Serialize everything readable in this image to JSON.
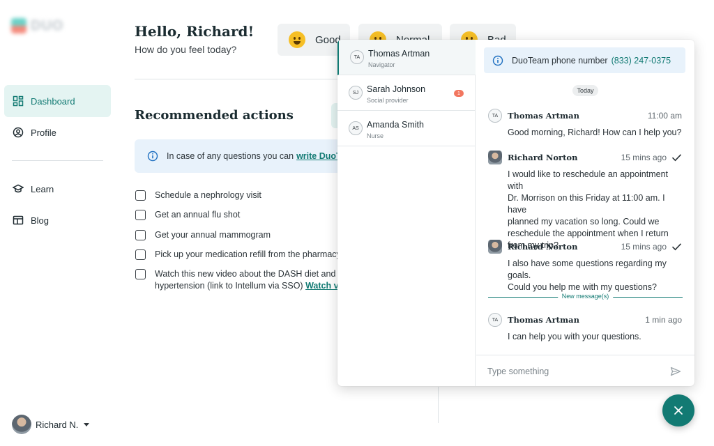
{
  "brand": {
    "logo_text": "DUO"
  },
  "sidebar": {
    "items": [
      {
        "label": "Dashboard",
        "icon": "dashboard-icon",
        "active": true
      },
      {
        "label": "Profile",
        "icon": "profile-icon",
        "active": false
      },
      {
        "label": "Learn",
        "icon": "graduation-cap-icon",
        "active": false
      },
      {
        "label": "Blog",
        "icon": "blog-icon",
        "active": false
      }
    ],
    "user": {
      "name": "Richard N."
    }
  },
  "header": {
    "greeting": "Hello, Richard!",
    "question": "How do you feel today?",
    "moods": [
      "Good",
      "Normal",
      "Bad"
    ]
  },
  "recommended": {
    "title": "Recommended actions",
    "info_text": "In case of any questions you can",
    "info_link": "write DuoTeam",
    "tasks": [
      {
        "text": "Schedule a nephrology visit"
      },
      {
        "text": "Get an annual flu shot"
      },
      {
        "text": "Get your annual mammogram"
      },
      {
        "text": "Pick up your medication refill from the pharmacy"
      },
      {
        "text_line1": "Watch this new video about the DASH diet and its",
        "text_line2": "hypertension (link to Intellum via SSO)",
        "link": "Watch video"
      }
    ]
  },
  "chat": {
    "contacts": [
      {
        "initials": "TA",
        "name": "Thomas Artman",
        "role": "Navigator",
        "unread": null
      },
      {
        "initials": "SJ",
        "name": "Sarah Johnson",
        "role": "Social provider",
        "unread": "1"
      },
      {
        "initials": "AS",
        "name": "Amanda Smith",
        "role": "Nurse",
        "unread": null
      }
    ],
    "phone_label": "DuoTeam phone number",
    "phone_number": "(833) 247-0375",
    "date_divider": "Today",
    "messages": [
      {
        "author": "Thomas Artman",
        "initials": "TA",
        "time": "11:00 am",
        "text": "Good morning, Richard! How can I help you?",
        "read": false
      },
      {
        "author": "Richard Norton",
        "initials": null,
        "time": "15 mins ago",
        "read": true,
        "lines": [
          "I would like to reschedule an appointment with",
          "Dr. Morrison on this Friday at 11:00 am. I have",
          "planned my vacation so long. Could we",
          "reschedule the appointment when I return",
          "from my trip?"
        ]
      },
      {
        "author": "Richard Norton",
        "initials": null,
        "time": "15 mins ago",
        "read": true,
        "lines": [
          "I also have some questions regarding my goals.",
          "Could you help me with my questions?"
        ]
      },
      {
        "author": "Thomas Artman",
        "initials": "TA",
        "time": "1 min ago",
        "text": "I can help you with your questions.",
        "read": false
      }
    ],
    "new_messages_label": "New message(s)",
    "composer_placeholder": "Type something"
  },
  "colors": {
    "accent": "#127a73",
    "accent_light": "#e4f4f2",
    "info_bg": "#e8f2fb",
    "badge": "#f2765f"
  }
}
